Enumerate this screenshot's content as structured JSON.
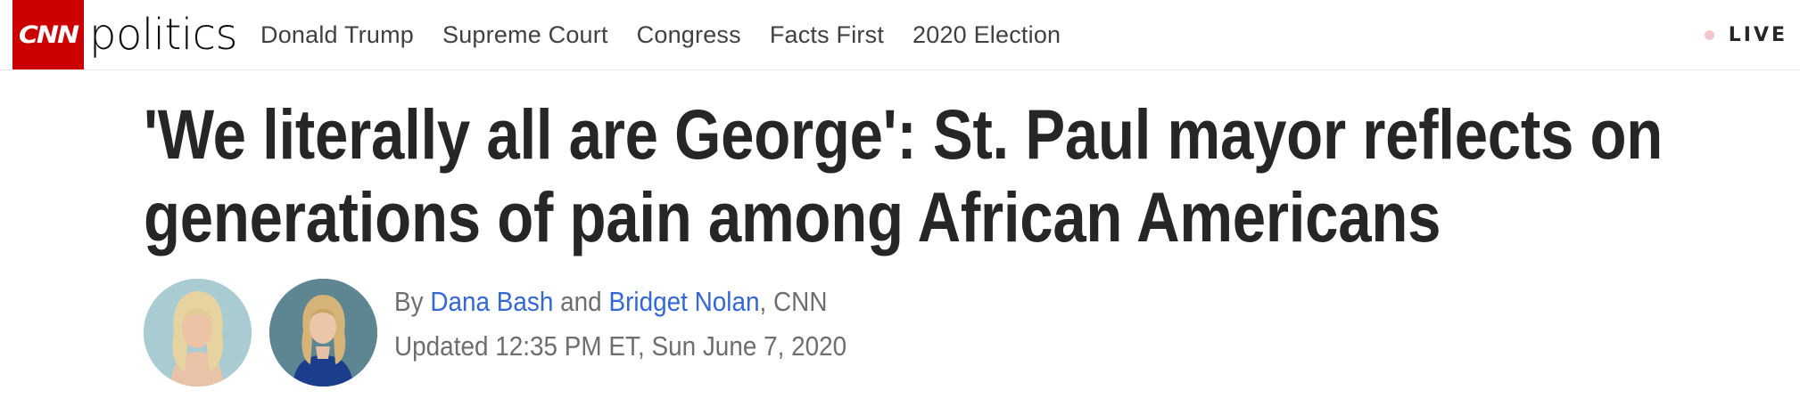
{
  "header": {
    "logo_text": "CNN",
    "section": "politics",
    "nav": [
      "Donald Trump",
      "Supreme Court",
      "Congress",
      "Facts First",
      "2020 Election"
    ],
    "live_label": "LIVE"
  },
  "article": {
    "headline_line1": "'We literally all are George': St. Paul mayor reflects on",
    "headline_line2": "generations of pain among African Americans",
    "by_prefix": "By",
    "author1": "Dana Bash",
    "and_word": "and",
    "author2": "Bridget Nolan",
    "outlet": ", CNN",
    "updated": "Updated 12:35 PM ET, Sun June 7, 2020"
  },
  "colors": {
    "brand_red": "#cc0000",
    "author_link": "#3367d6",
    "live_dot": "#f3c6cb"
  }
}
